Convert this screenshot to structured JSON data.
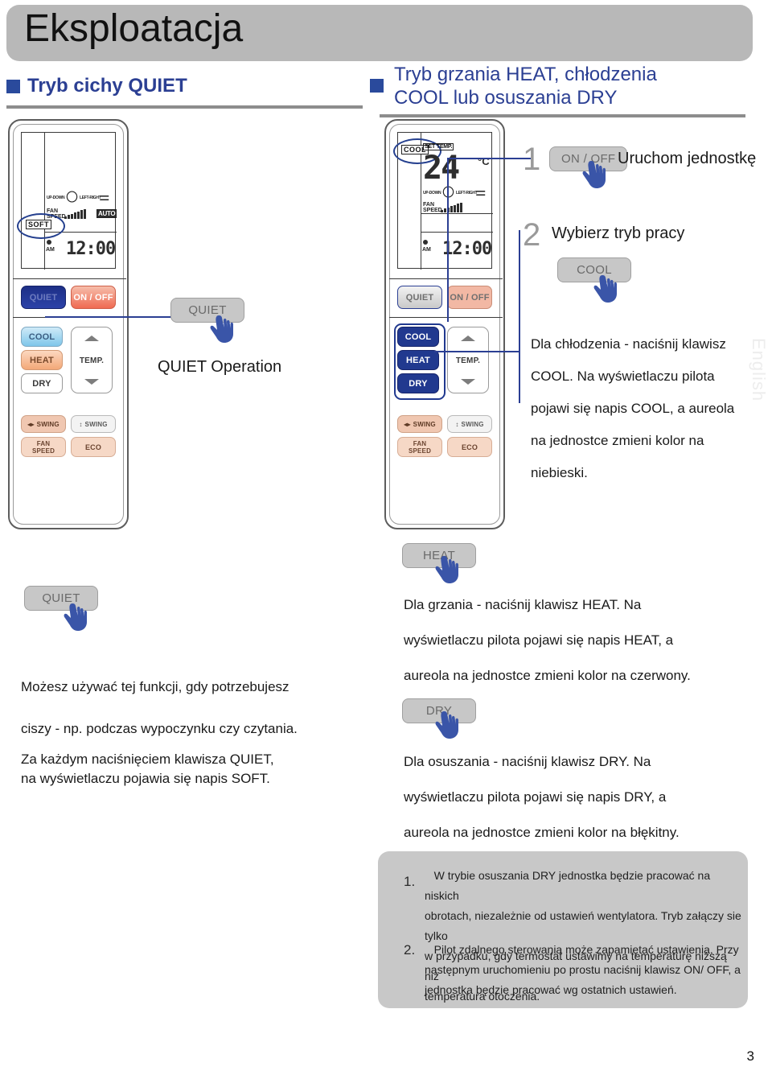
{
  "header": {
    "title": "Eksploatacja"
  },
  "sections": {
    "left": {
      "title": "Tryb cichy QUIET",
      "bullet_color": "#2a4a9c"
    },
    "right": {
      "line1": "Tryb grzania HEAT, chłodzenia",
      "line2": "COOL lub osuszania DRY",
      "bullet_color": "#2a4a9c"
    }
  },
  "remote_left": {
    "lcd": {
      "mode": "SOFT",
      "swing_updown_label": "UP-DOWN",
      "swing_leftright_label": "LEFT-RIGHT",
      "fan_label_line1": "FAN",
      "fan_label_line2": "SPEED",
      "auto": "AUTO",
      "am": "AM",
      "clock": "12:00"
    },
    "buttons": {
      "quiet": "QUIET",
      "onoff": "ON / OFF",
      "cool": "COOL",
      "heat": "HEAT",
      "dry": "DRY",
      "temp": "TEMP.",
      "swing_lr": "SWING",
      "swing_ud": "SWING",
      "fanspeed_line1": "FAN",
      "fanspeed_line2": "SPEED",
      "eco": "ECO"
    }
  },
  "remote_right": {
    "lcd": {
      "mode": "COOL",
      "set_temp_label": "SET TEMP.",
      "temperature": "24",
      "unit": "°C",
      "swing_updown_label": "UP-DOWN",
      "swing_leftright_label": "LEFT-RIGHT",
      "fan_label_line1": "FAN",
      "fan_label_line2": "SPEED",
      "am": "AM",
      "clock": "12:00"
    },
    "buttons": {
      "quiet": "QUIET",
      "onoff": "ON / OFF",
      "cool": "COOL",
      "heat": "HEAT",
      "dry": "DRY",
      "temp": "TEMP.",
      "swing_lr": "SWING",
      "swing_ud": "SWING",
      "fanspeed_line1": "FAN",
      "fanspeed_line2": "SPEED",
      "eco": "ECO"
    }
  },
  "callouts": {
    "quiet_top": "QUIET",
    "quiet_top_caption": "QUIET Operation",
    "quiet_mid": "QUIET",
    "onoff": "ON / OFF",
    "cool": "COOL",
    "heat": "HEAT",
    "dry": "DRY"
  },
  "steps": {
    "one_num": "1",
    "one_text": "Uruchom jednostkę",
    "two_num": "2",
    "two_text": "Wybierz tryb pracy"
  },
  "paragraphs": {
    "cool": [
      "Dla chłodzenia - naciśnij klawisz",
      "COOL. Na wyświetlaczu pilota",
      "pojawi się napis COOL, a aureola",
      "na jednostce zmieni kolor na",
      "niebieski."
    ],
    "heat": [
      "Dla grzania - naciśnij klawisz HEAT. Na",
      "wyświetlaczu pilota pojawi się napis HEAT, a",
      "aureola na jednostce zmieni kolor na czerwony."
    ],
    "dry": [
      "Dla osuszania - naciśnij klawisz DRY. Na",
      "wyświetlaczu pilota pojawi się napis DRY, a",
      "aureola na jednostce zmieni kolor na błękitny."
    ],
    "quiet_usage": [
      "Możesz używać tej funkcji, gdy potrzebujesz",
      "ciszy - np. podczas wypoczynku czy czytania."
    ],
    "quiet_soft": [
      "Za każdym naciśnięciem klawisza QUIET,",
      "na wyświetlaczu pojawia się napis SOFT."
    ]
  },
  "notes": [
    {
      "num": "1.",
      "lines": [
        "W trybie osuszania DRY jednostka będzie pracować na niskich",
        "obrotach, niezależnie od ustawień wentylatora. Tryb załączy sie tylko",
        "w przypadku, gdy termostat ustawimy na temperaturę niższą niż",
        "temperatura otoczenia."
      ]
    },
    {
      "num": "2.",
      "lines": [
        "Pilot zdalnego sterowania może zapamiętać ustawienia. Przy",
        "następnym uruchomieniu po prostu naciśnij klawisz ON/ OFF, a",
        "jednostka będzie pracować wg ostatnich ustawień."
      ]
    }
  ],
  "watermark": "English",
  "page_number": "3"
}
